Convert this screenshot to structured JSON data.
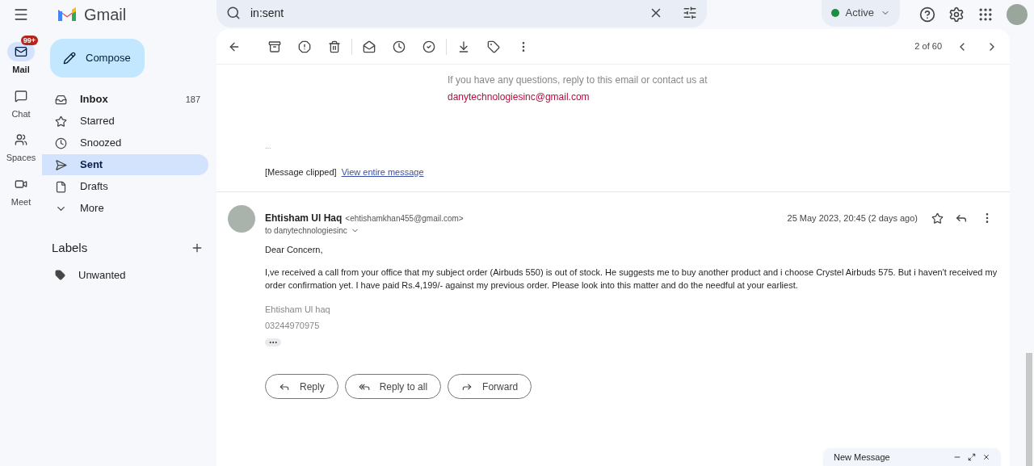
{
  "header": {
    "logo": "Gmail",
    "search": {
      "value": "in:sent"
    },
    "status": {
      "label": "Active",
      "color": "#1e8e3e"
    }
  },
  "rail": [
    {
      "label": "Mail",
      "badge": "99+",
      "selected": true,
      "kind": "mail"
    },
    {
      "label": "Chat",
      "selected": false,
      "kind": "chat"
    },
    {
      "label": "Spaces",
      "selected": false,
      "kind": "spaces"
    },
    {
      "label": "Meet",
      "selected": false,
      "kind": "meet"
    }
  ],
  "compose": "Compose",
  "folders": [
    {
      "label": "Inbox",
      "count": "187",
      "selected": false,
      "bold": true,
      "kind": "inbox"
    },
    {
      "label": "Starred",
      "selected": false,
      "bold": false,
      "kind": "star"
    },
    {
      "label": "Snoozed",
      "selected": false,
      "bold": false,
      "kind": "clock"
    },
    {
      "label": "Sent",
      "selected": true,
      "bold": false,
      "kind": "send"
    },
    {
      "label": "Drafts",
      "selected": false,
      "bold": false,
      "kind": "file"
    },
    {
      "label": "More",
      "selected": false,
      "bold": false,
      "kind": "more"
    }
  ],
  "labels": {
    "title": "Labels",
    "items": [
      "Unwanted"
    ]
  },
  "toolbar": {
    "pager": "2 of 60"
  },
  "previous_message": {
    "contact_line": "If you have any questions, reply to this email or contact us at",
    "email": "danytechnologiesinc@gmail.com",
    "ellipsis": "...",
    "clipped": "[Message clipped]",
    "view_link": "View entire message"
  },
  "message": {
    "sender": "Ehtisham Ul Haq",
    "sender_email": "<ehtishamkhan455@gmail.com>",
    "to": "to danytechnologiesinc",
    "date": "25 May 2023, 20:45 (2 days ago)",
    "starred": false,
    "body": [
      "Dear Concern,",
      "I,ve received a call from your office that my subject order (Airbuds 550) is out of stock. He suggests me to buy another product and i choose Crystel Airbuds 575. But i haven't received my order confirmation yet. I have paid Rs.4,199/- against my previous order. Please look into this matter and do the needful at your earliest."
    ],
    "signature": [
      "Ehtisham Ul haq",
      "03244970975"
    ]
  },
  "actions": [
    {
      "label": "Reply",
      "kind": "reply"
    },
    {
      "label": "Reply to all",
      "kind": "replyall"
    },
    {
      "label": "Forward",
      "kind": "forward"
    }
  ],
  "new_message": {
    "title": "New Message"
  }
}
